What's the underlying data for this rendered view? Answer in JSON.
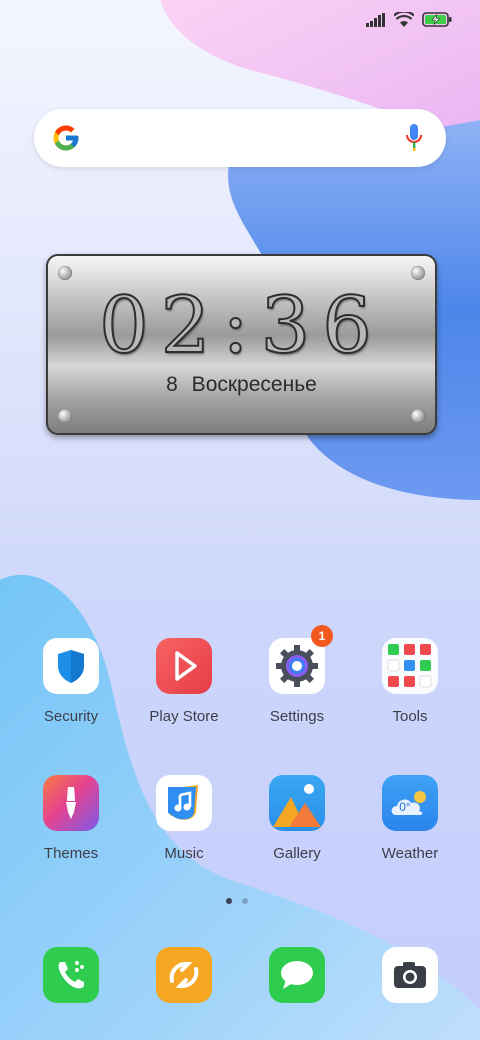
{
  "wallpaper": {
    "colors": {
      "top_pink": "#f7c8f0",
      "blue": "#5b8ff0",
      "light_blue": "#8fc6f8"
    }
  },
  "status_bar": {
    "icons": [
      "signal-icon",
      "wifi-icon",
      "battery-charging-icon"
    ],
    "battery_color": "#3ecf4a"
  },
  "search": {
    "icons": [
      "google-logo-icon",
      "microphone-icon"
    ]
  },
  "clock_widget": {
    "time": "02:36",
    "date": "8  Воскресенье"
  },
  "apps": [
    {
      "label": "Security",
      "icon": "shield-icon",
      "color": "#1e8fe8"
    },
    {
      "label": "Play Store",
      "icon": "play-triangle-icon",
      "color": "#f0484e"
    },
    {
      "label": "Settings",
      "icon": "gear-icon",
      "color": "#3c5da8",
      "badge": "1"
    },
    {
      "label": "Tools",
      "icon": "tools-folder-icon",
      "color": "#ffffff"
    },
    {
      "label": "Themes",
      "icon": "paintbrush-icon",
      "color": "#a45ad8"
    },
    {
      "label": "Music",
      "icon": "music-note-icon",
      "color": "#2f8ef2"
    },
    {
      "label": "Gallery",
      "icon": "mountains-icon",
      "color": "#2ba0ef"
    },
    {
      "label": "Weather",
      "icon": "weather-icon",
      "color": "#2f90f0",
      "temperature": "0°"
    }
  ],
  "page_indicator": {
    "pages": 2,
    "current": 1
  },
  "dock": [
    {
      "icon": "phone-icon",
      "color": "#2ecc4f"
    },
    {
      "icon": "mi-app-icon",
      "color": "#f5a623"
    },
    {
      "icon": "message-icon",
      "color": "#2ecc4f"
    },
    {
      "icon": "camera-icon",
      "color": "#ffffff"
    }
  ]
}
